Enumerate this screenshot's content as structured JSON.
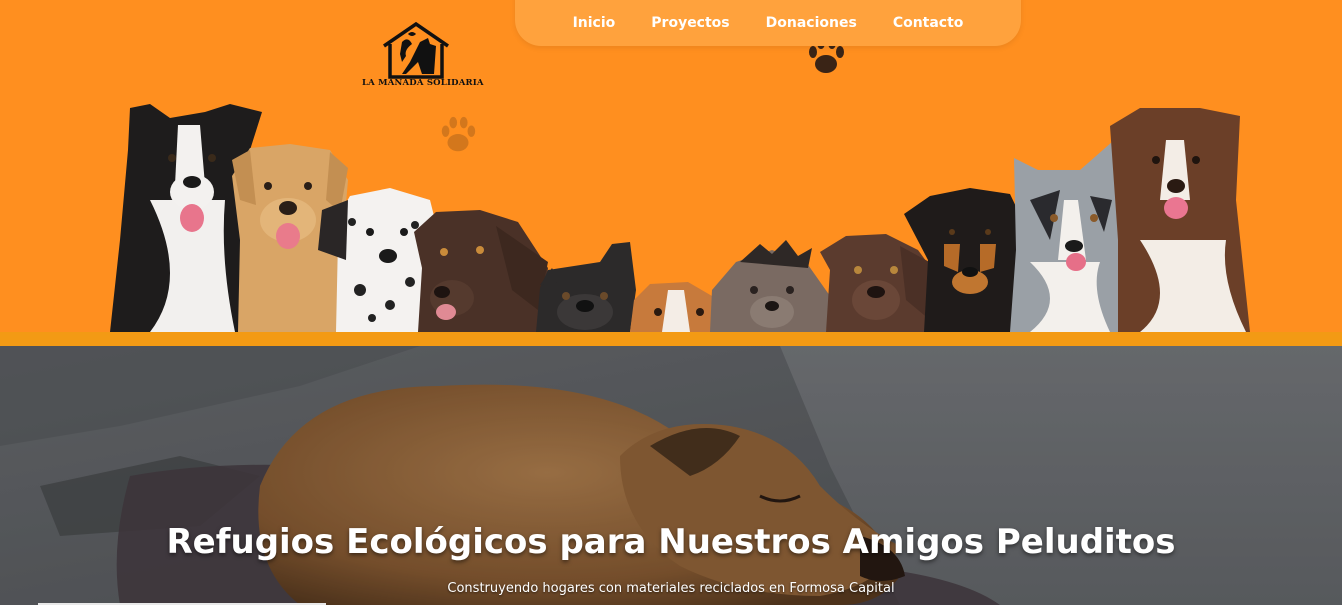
{
  "nav": {
    "items": [
      {
        "label": "Inicio"
      },
      {
        "label": "Proyectos"
      },
      {
        "label": "Donaciones"
      },
      {
        "label": "Contacto"
      }
    ]
  },
  "logo": {
    "text": "LA MANADA SOLIDARIA",
    "icon": "house-with-pets-icon"
  },
  "hero": {
    "title": "Refugios Ecológicos para Nuestros Amigos Peluditos",
    "subtitle": "Construyendo hogares con materiales reciclados en Formosa Capital"
  },
  "colors": {
    "header_bg": "#ff8f1f",
    "nav_bg": "#ffa23d",
    "divider": "#f39a14",
    "text_light": "#ffffff"
  }
}
